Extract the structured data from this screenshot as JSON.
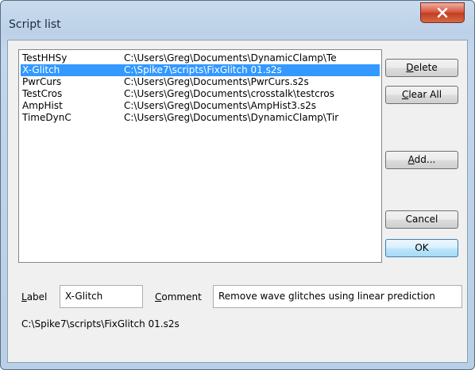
{
  "window": {
    "title": "Script list"
  },
  "scripts": [
    {
      "label": "TestHHSy",
      "path": "C:\\Users\\Greg\\Documents\\DynamicClamp\\Te",
      "selected": false
    },
    {
      "label": "X-Glitch",
      "path": "C:\\Spike7\\scripts\\FixGlitch 01.s2s",
      "selected": true
    },
    {
      "label": "PwrCurs",
      "path": "C:\\Users\\Greg\\Documents\\PwrCurs.s2s",
      "selected": false
    },
    {
      "label": "TestCros",
      "path": "C:\\Users\\Greg\\Documents\\crosstalk\\testcros",
      "selected": false
    },
    {
      "label": "AmpHist",
      "path": "C:\\Users\\Greg\\Documents\\AmpHist3.s2s",
      "selected": false
    },
    {
      "label": "TimeDynC",
      "path": "C:\\Users\\Greg\\Documents\\DynamicClamp\\Tir",
      "selected": false
    }
  ],
  "buttons": {
    "delete": {
      "pre": "",
      "key": "D",
      "post": "elete"
    },
    "clear_all": {
      "pre": "",
      "key": "C",
      "post": "lear All"
    },
    "add": {
      "pre": "",
      "key": "A",
      "post": "dd..."
    },
    "cancel": "Cancel",
    "ok": "OK"
  },
  "label_field": {
    "caption_key": "L",
    "caption_rest": "abel",
    "value": "X-Glitch"
  },
  "comment_field": {
    "caption_key": "C",
    "caption_rest": "omment",
    "value": "Remove wave glitches using linear prediction"
  },
  "selected_path": "C:\\Spike7\\scripts\\FixGlitch 01.s2s",
  "colors": {
    "selection": "#3399ff",
    "close_button": "#c94a30"
  }
}
